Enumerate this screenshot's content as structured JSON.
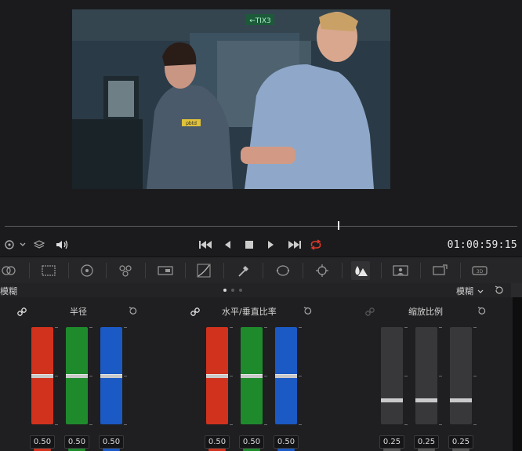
{
  "viewer": {
    "exit_sign": "←TIX3",
    "badge_text": "pbtd"
  },
  "scrubber": {
    "position_fraction": 0.65
  },
  "transport": {
    "timecode": "01:00:59:15"
  },
  "palette": {
    "active": "blur-palette-icon",
    "icons": [
      "camera-raw-icon",
      "color-match-icon",
      "color-wheels-icon",
      "rgb-mixer-icon",
      "motion-effects-icon",
      "curves-icon",
      "qualifier-icon",
      "power-window-icon",
      "tracker-icon",
      "blur-palette-icon",
      "key-icon",
      "sizing-icon",
      "3d-icon"
    ]
  },
  "header": {
    "title": "模糊",
    "mode_label": "模糊",
    "page_dots": 3,
    "active_dot": 0
  },
  "groups": [
    {
      "label": "半径",
      "linked": true,
      "sliders": [
        {
          "color": "red",
          "value": "0.50",
          "level": 0.5
        },
        {
          "color": "green",
          "value": "0.50",
          "level": 0.5
        },
        {
          "color": "blue",
          "value": "0.50",
          "level": 0.5
        }
      ]
    },
    {
      "label": "水平/垂直比率",
      "linked": true,
      "sliders": [
        {
          "color": "red",
          "value": "0.50",
          "level": 0.5
        },
        {
          "color": "green",
          "value": "0.50",
          "level": 0.5
        },
        {
          "color": "blue",
          "value": "0.50",
          "level": 0.5
        }
      ]
    },
    {
      "label": "缩放比例",
      "linked": false,
      "sliders": [
        {
          "color": "gray",
          "value": "0.25",
          "level": 0.25
        },
        {
          "color": "gray",
          "value": "0.25",
          "level": 0.25
        },
        {
          "color": "gray",
          "value": "0.25",
          "level": 0.25
        }
      ]
    }
  ],
  "colors": {
    "red": "#d0321e",
    "green": "#1f8a2c",
    "blue": "#1b59c4",
    "gray": "#3b3b3e",
    "accent_loop": "#e0392b"
  }
}
